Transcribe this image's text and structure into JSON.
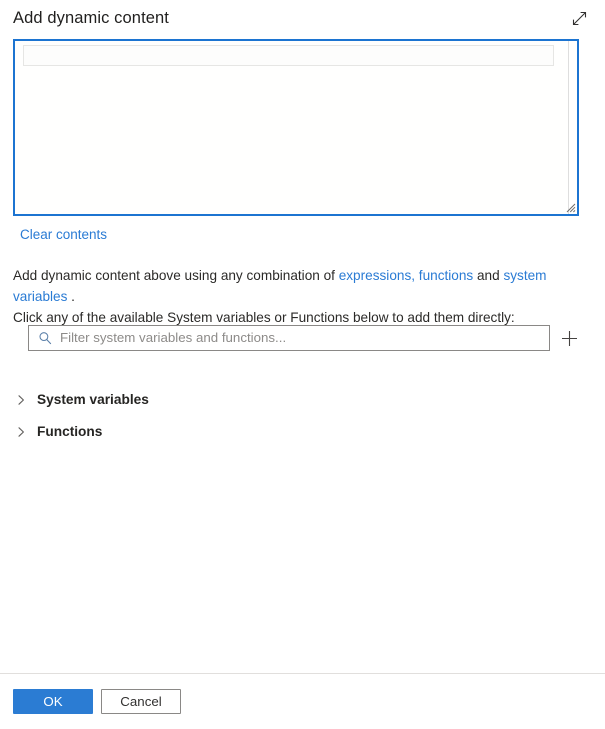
{
  "header": {
    "title": "Add dynamic content",
    "expand_icon": "expand-diagonal-icon"
  },
  "editor": {
    "value": "",
    "resize_grip_icon": "resize-grip-icon"
  },
  "clear_link": {
    "label": "Clear contents"
  },
  "description": {
    "line1_part1": "Add dynamic content above using any combination of ",
    "line1_link1": "expressions, functions",
    "line1_part2": " and ",
    "line1_link2": "system variables",
    "line1_part3": " .",
    "line2": "Click any of the available System variables or Functions below to add them directly:"
  },
  "filter": {
    "placeholder": "Filter system variables and functions...",
    "value": "",
    "search_icon": "search-icon",
    "add_icon": "plus-icon"
  },
  "sections": [
    {
      "label": "System variables",
      "expanded": false,
      "chevron_icon": "chevron-right-icon"
    },
    {
      "label": "Functions",
      "expanded": false,
      "chevron_icon": "chevron-right-icon"
    }
  ],
  "footer": {
    "ok_label": "OK",
    "cancel_label": "Cancel"
  },
  "colors": {
    "accent": "#2b7cd3",
    "link": "#2a7bd4",
    "editor_border": "#1c74d1",
    "text": "#323130",
    "divider": "#e1dfdd"
  }
}
